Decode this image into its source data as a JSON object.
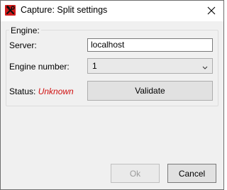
{
  "window": {
    "title": "Capture: Split settings",
    "app_icon": "tools-icon",
    "close_icon": "close-icon"
  },
  "group": {
    "label": "Engine:"
  },
  "server": {
    "label": "Server:",
    "value": "localhost"
  },
  "engine_number": {
    "label": "Engine number:",
    "selected": "1"
  },
  "status": {
    "label": "Status:",
    "value": "Unknown",
    "value_color": "#d01010"
  },
  "buttons": {
    "validate": "Validate",
    "ok": "Ok",
    "cancel": "Cancel"
  }
}
